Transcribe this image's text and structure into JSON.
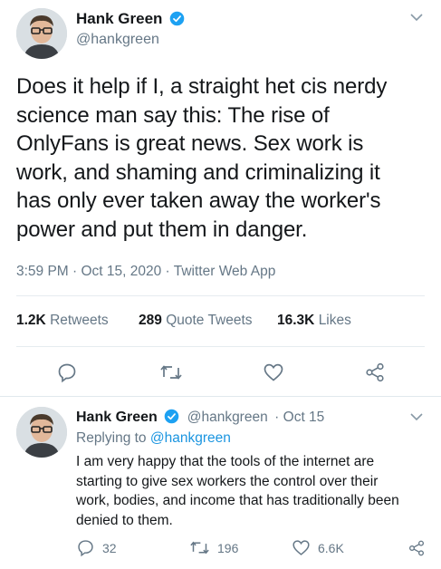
{
  "tweet": {
    "author": "Hank Green",
    "handle": "@hankgreen",
    "text": "Does it help if I, a straight het cis nerdy science man say this: The rise of OnlyFans is great news. Sex work is work, and shaming and criminalizing it has only ever taken away the worker's power and put them in danger.",
    "lines": [
      "Does it help if I, a straight het cis nerdy",
      "science man say this: The rise of",
      "OnlyFans is great news. Sex work is",
      "work, and shaming and criminalizing it",
      "has only ever taken away the worker's",
      "power and put them in danger."
    ],
    "timestamp": "3:59 PM · Oct 15, 2020 · Twitter Web App",
    "retweets_count": "1.2K",
    "retweets_label": "Retweets",
    "quotes_count": "289",
    "quotes_label": "Quote Tweets",
    "likes_count": "16.3K",
    "likes_label": "Likes"
  },
  "reply": {
    "author": "Hank Green",
    "handle": "@hankgreen",
    "date": "· Oct 15",
    "replying_prefix": "Replying to",
    "replying_handle": "@hankgreen",
    "lines": [
      "I am very happy that the tools of the internet are",
      "starting to give sex workers the control over their",
      "work, bodies, and income that has traditionally been",
      "denied to them."
    ],
    "reply_count": "32",
    "retweet_count": "196",
    "like_count": "6.6K"
  },
  "icons": [
    "verified-badge-icon",
    "chevron-down-icon",
    "reply-icon",
    "retweet-icon",
    "like-icon",
    "share-icon"
  ],
  "colors": {
    "accent": "#1da1f2",
    "muted": "#657786",
    "divider": "#e6ecf0"
  }
}
